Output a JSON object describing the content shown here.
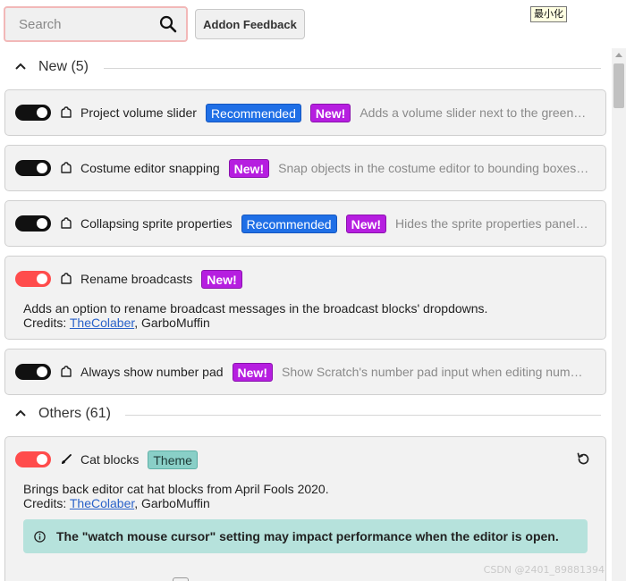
{
  "toolbar": {
    "search_placeholder": "Search",
    "feedback_label": "Addon Feedback",
    "minimize_tooltip": "最小化"
  },
  "sections": [
    {
      "title": "New (5)",
      "expanded": true
    },
    {
      "title": "Others (61)",
      "expanded": true
    }
  ],
  "badges": {
    "recommended": "Recommended",
    "new": "New!",
    "theme": "Theme"
  },
  "addons": [
    {
      "name": "Project volume slider",
      "enabled": false,
      "icon": "puzzle-icon",
      "badges": [
        "Recommended",
        "New!"
      ],
      "description": "Adds a volume slider next to the green flag."
    },
    {
      "name": "Costume editor snapping",
      "enabled": false,
      "icon": "puzzle-icon",
      "badges": [
        "New!"
      ],
      "description": "Snap objects in the costume editor to bounding boxes and vector nodes."
    },
    {
      "name": "Collapsing sprite properties",
      "enabled": false,
      "icon": "puzzle-icon",
      "badges": [
        "Recommended",
        "New!"
      ],
      "description": "Hides the sprite properties panel by default."
    },
    {
      "name": "Rename broadcasts",
      "enabled": true,
      "icon": "puzzle-icon",
      "badges": [
        "New!"
      ],
      "description": "Adds an option to rename broadcast messages in the broadcast blocks' dropdowns.",
      "credits_label": "Credits:",
      "credits": [
        "TheColaber",
        "GarboMuffin"
      ]
    },
    {
      "name": "Always show number pad",
      "enabled": false,
      "icon": "puzzle-icon",
      "badges": [
        "New!"
      ],
      "description": "Show Scratch's number pad input when editing number fields."
    },
    {
      "name": "Cat blocks",
      "enabled": true,
      "icon": "brush-icon",
      "badges": [
        "Theme"
      ],
      "description": "Brings back editor cat hat blocks from April Fools 2020.",
      "credits_label": "Credits:",
      "credits": [
        "TheColaber",
        "GarboMuffin"
      ],
      "notice": "The \"watch mouse cursor\" setting may impact performance when the editor is open."
    }
  ],
  "watermark": "CSDN @2401_89881394",
  "colors": {
    "toggle_on": "#ff4c4c",
    "toggle_off": "#111111",
    "badge_recommended": "#1f6fe6",
    "badge_new": "#b61ee0",
    "badge_theme": "#89cfc7",
    "notice_bg": "#b6e2dc",
    "link": "#2a62c9"
  }
}
